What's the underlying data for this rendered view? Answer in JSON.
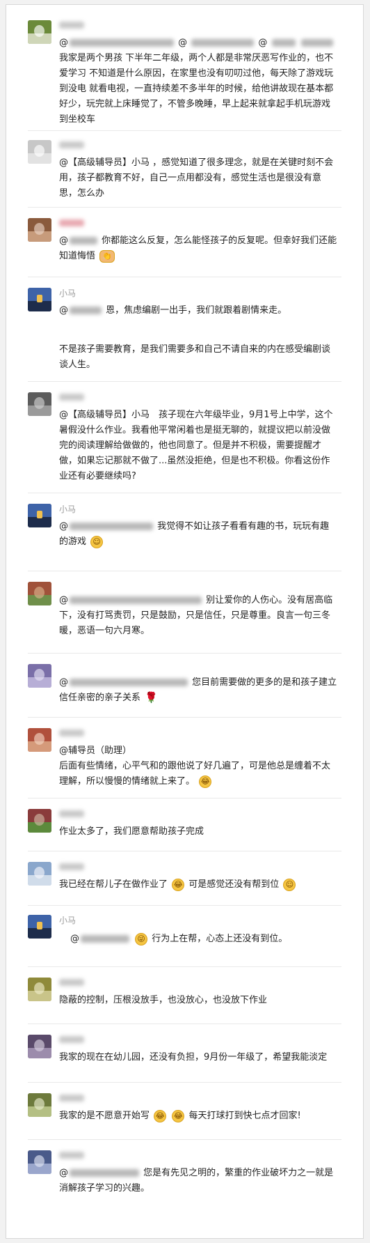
{
  "comments": [
    {
      "name_type": "blur",
      "avatar_colors": [
        "#6b8a3a",
        "#cfd6b8",
        "#ffffff"
      ],
      "text": "我家是两个男孩 下半年二年级，两个人都是非常厌恶写作业的，也不爱学习 不知道是什么原因，在家里也没有叨叨过他，每天除了游戏玩到没电 就看电视，一直持续差不多半年的时候，给他讲故现在基本都好少，玩完就上床睡觉了，不管多晚睡，早上起来就拿起手机玩游戏到坐校车"
    },
    {
      "name_type": "blur",
      "avatar_colors": [
        "#c7c7c7",
        "#e2e2e2",
        "#ffffff"
      ],
      "text": "@【高级辅导员】小马 ，感觉知道了很多理念，就是在关键时刻不会用，孩子都教育不好，自己一点用都没有，感觉生活也是很没有意思，怎么办"
    },
    {
      "name_type": "blur-pink",
      "avatar_colors": [
        "#8a5a3c",
        "#c79b7b",
        "#e9d3c3"
      ],
      "text": "你都能这么反复，怎么能怪孩子的反复呢。但幸好我们还能知道悔悟"
    },
    {
      "name": "小马",
      "avatar": "lantern",
      "text": "恩，焦虑编剧一出手，我们就跟着剧情来走。",
      "text2": "不是孩子需要教育，是我们需要多和自己不请自来的内在感受编剧谈谈人生。"
    },
    {
      "name_type": "blur",
      "avatar_colors": [
        "#5c5c5c",
        "#9a9a9a",
        "#cfcfcf"
      ],
      "text": "@【高级辅导员】小马　孩子现在六年级毕业，9月1号上中学，这个暑假没什么作业。我看他平常闲着也是挺无聊的，就提议把以前没做完的阅读理解给做做的，他也同意了。但是并不积极，需要提醒才做，如果忘记那就不做了...虽然没拒绝，但是也不积极。你看这份作业还有必要继续吗?"
    },
    {
      "name": "小马",
      "avatar": "lantern",
      "text": "我觉得不如让孩子看看有趣的书，玩玩有趣的游戏"
    },
    {
      "name_type": "none",
      "avatar_colors": [
        "#a0523a",
        "#6f8f4a",
        "#d8b08a"
      ],
      "text": "别让爱你的人伤心。没有居高临下，没有打骂责罚，只是鼓励，只是信任，只是尊重。良言一句三冬暖，恶语一句六月寒。"
    },
    {
      "name_type": "none",
      "avatar_colors": [
        "#7a6fa8",
        "#b7aed6",
        "#e5e0f2"
      ],
      "text": "您目前需要做的更多的是和孩子建立信任亲密的亲子关系"
    },
    {
      "name_type": "blur",
      "avatar_colors": [
        "#b0503c",
        "#d59a7a",
        "#f2d2c0"
      ],
      "text": "@辅导员（助理）",
      "text2": "后面有些情绪，心平气和的跟他说了好几遍了，可是他总是缠着不太理解，所以慢慢的情绪就上来了。"
    },
    {
      "name_type": "blur",
      "avatar_colors": [
        "#8a3b3b",
        "#5c8a3c",
        "#d0b7a3"
      ],
      "text": "作业太多了，我们愿意帮助孩子完成"
    },
    {
      "name_type": "blur",
      "avatar_colors": [
        "#8aa7cc",
        "#d0dcea",
        "#f2f5fa"
      ],
      "text": "我已经在帮儿子在做作业了",
      "text2": "可是感觉还没有帮到位"
    },
    {
      "name": "小马",
      "avatar": "lantern",
      "text": "行为上在帮，心态上还没有到位。"
    },
    {
      "name_type": "blur",
      "avatar_colors": [
        "#8f8a3a",
        "#c9c489",
        "#eeebc8"
      ],
      "text": "隐蔽的控制，压根没放手，也没放心，也没放下作业"
    },
    {
      "name_type": "blur",
      "avatar_colors": [
        "#5a4a6a",
        "#9c8cac",
        "#d8d0e0"
      ],
      "text": "我家的现在在幼儿园，还没有负担，9月份一年级了，希望我能淡定"
    },
    {
      "name_type": "blur",
      "avatar_colors": [
        "#6d7a3c",
        "#b4bf83",
        "#e6ebcb"
      ],
      "text": "我家的是不愿意开始写",
      "text2": "每天打球打到快七点才回家!"
    },
    {
      "name_type": "blur",
      "avatar_colors": [
        "#4a5a8a",
        "#9aa6cc",
        "#dfe4f2"
      ],
      "text": "您是有先见之明的，繁重的作业破坏力之一就是消解孩子学习的兴趣。"
    }
  ],
  "ui": {
    "name_label": "小马",
    "emoji_smile": "☺",
    "emoji_laugh": "😂",
    "emoji_rose": "🌹",
    "emoji_hand": "👏",
    "emoji_tongue": "😜"
  },
  "colors": {
    "page_bg": "#f2f2f2",
    "card_bg": "#ffffff",
    "text": "#222222",
    "name": "#9a9a9a",
    "divider": "#e9e9e9"
  }
}
